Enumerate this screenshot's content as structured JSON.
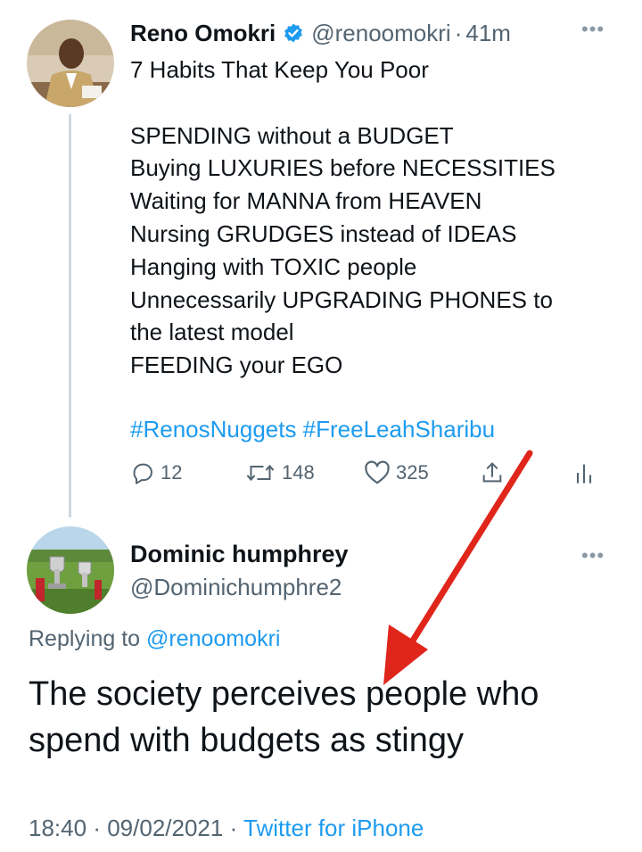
{
  "tweet": {
    "author": {
      "name": "Reno Omokri",
      "handle": "@renoomokri",
      "verified": true
    },
    "separator": "·",
    "time": "41m",
    "more_icon": "more-dots-icon",
    "body_lines": [
      "7 Habits That Keep You Poor",
      "",
      "SPENDING without a BUDGET",
      "Buying LUXURIES before NECESSITIES",
      "Waiting for MANNA from HEAVEN",
      "Nursing GRUDGES instead of IDEAS",
      "Hanging with TOXIC people",
      "Unnecessarily UPGRADING PHONES to",
      "the latest model",
      "FEEDING your EGO"
    ],
    "hashtags": "#RenosNuggets #FreeLeahSharibu",
    "actions": {
      "replies": "12",
      "retweets": "148",
      "likes": "325",
      "reply_icon": "reply-icon",
      "retweet_icon": "retweet-icon",
      "like_icon": "heart-icon",
      "share_icon": "share-icon",
      "stats_icon": "stats-icon"
    }
  },
  "reply": {
    "author": {
      "name": "Dominic humphrey",
      "handle": "@Dominichumphre2"
    },
    "replying_prefix": "Replying to",
    "replying_to": "@renoomokri",
    "text_lines": [
      "The society perceives people who",
      "spend with budgets as stingy"
    ],
    "time": "18:40",
    "date": "09/02/2021",
    "separator": "·",
    "source": "Twitter for iPhone"
  },
  "colors": {
    "accent": "#1d9bf0",
    "secondary_text": "#536471",
    "primary_text": "#0f1419",
    "annotation_arrow": "#e0261b"
  }
}
